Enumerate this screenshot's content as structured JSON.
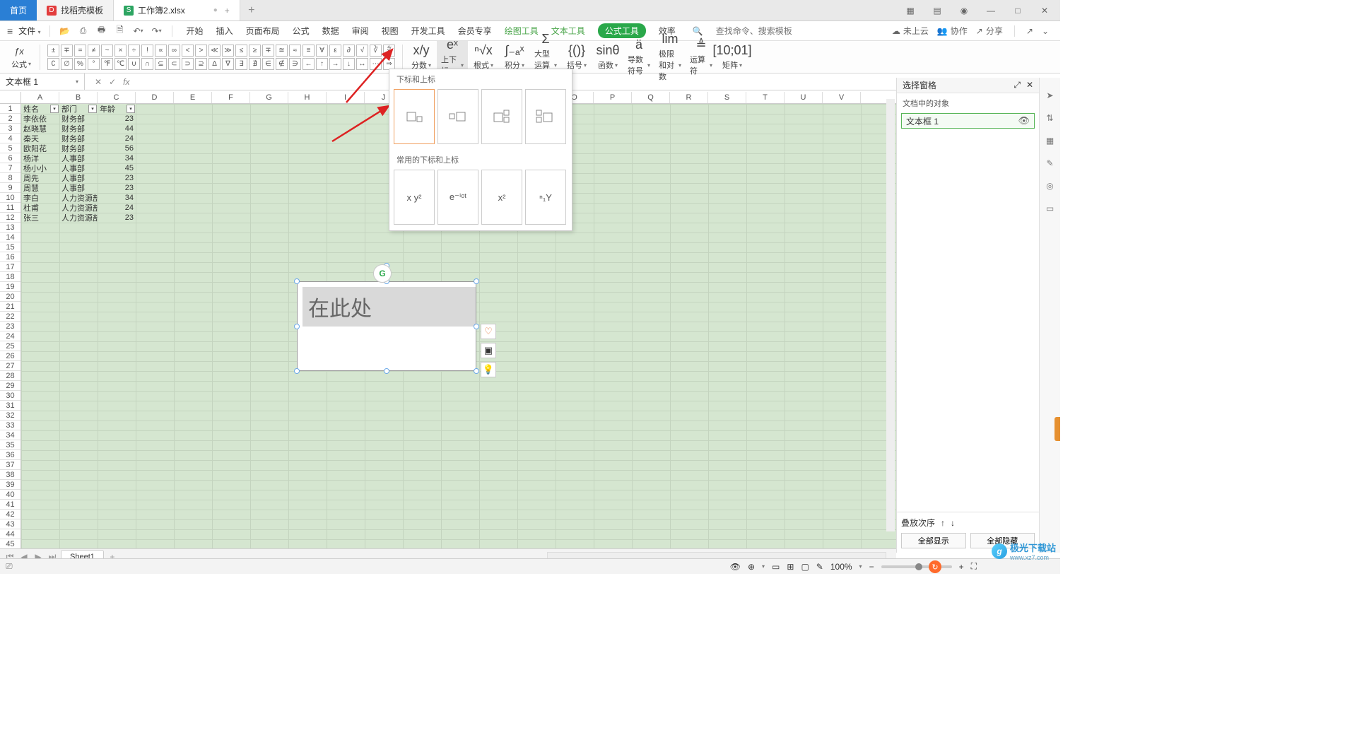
{
  "tabs": {
    "home": "首页",
    "template": "找稻壳模板",
    "doc": "工作簿2.xlsx",
    "dot": "●",
    "plus": "+"
  },
  "window_icons": {
    "grid": "▦",
    "apps": "▤",
    "user": "◉",
    "min": "—",
    "max": "□",
    "close": "✕"
  },
  "menu": {
    "file": "文件",
    "quick": {
      "open": "📂",
      "save": "⎙",
      "print": "🖶",
      "preview": "🗎",
      "undo": "↶",
      "redo": "↷"
    },
    "items": [
      "开始",
      "插入",
      "页面布局",
      "公式",
      "数据",
      "审阅",
      "视图",
      "开发工具",
      "会员专享"
    ],
    "draw": "绘图工具",
    "text": "文本工具",
    "formula": "公式工具",
    "effect": "效率",
    "search_placeholder": "查找命令、搜索模板",
    "cloud": "未上云",
    "collab": "协作",
    "share": "分享"
  },
  "ribbon": {
    "row1": [
      "±",
      "∓",
      "=",
      "≠",
      "~",
      "×",
      "÷",
      "!",
      "∝",
      "∞",
      "<",
      ">",
      "≪",
      "≫",
      "≤",
      "≥",
      "∓",
      "≅",
      "≈",
      "≡",
      "∀",
      "ε",
      "∂",
      "√",
      "∛",
      "∜"
    ],
    "row2": [
      "∁",
      "∅",
      "%",
      "°",
      "℉",
      "℃",
      "∪",
      "∩",
      "⊆",
      "⊂",
      "⊃",
      "⊇",
      "∆",
      "∇",
      "∃",
      "∄",
      "∈",
      "∉",
      "∋",
      "←",
      "↑",
      "→",
      "↓",
      "↔",
      "⋯",
      "⇒"
    ],
    "fx": "公式",
    "groups": [
      {
        "icon": "x/y",
        "label": "分数",
        "arrow": true
      },
      {
        "icon": "eˣ",
        "label": "上下标",
        "arrow": true,
        "active": true
      },
      {
        "icon": "ⁿ√x",
        "label": "根式",
        "arrow": true
      },
      {
        "icon": "∫₋ₐˣ",
        "label": "积分",
        "arrow": true
      },
      {
        "icon": "Σ",
        "label": "大型运算符",
        "arrow": true
      },
      {
        "icon": "{()} ",
        "label": "括号",
        "arrow": true
      },
      {
        "icon": "sinθ",
        "label": "函数",
        "arrow": true
      },
      {
        "icon": "ä",
        "label": "导数符号",
        "arrow": true
      },
      {
        "icon": "lim",
        "label": "极限和对数",
        "arrow": true
      },
      {
        "icon": "≜",
        "label": "运算符",
        "arrow": true
      },
      {
        "icon": "[10;01]",
        "label": "矩阵",
        "arrow": true
      }
    ]
  },
  "namebox": "文本框 1",
  "dropdown": {
    "title1": "下标和上标",
    "row1": [
      "□▫",
      "▫□",
      "□▫▫",
      "▫□▫"
    ],
    "title2": "常用的下标和上标",
    "row2": [
      "x y²",
      "e⁻ⁱᵒᵗ",
      "x²",
      "ⁿ₁Y"
    ]
  },
  "columns": [
    "A",
    "B",
    "C",
    "D",
    "E",
    "F",
    "G",
    "H",
    "I",
    "J",
    "K",
    "L",
    "M",
    "N",
    "O",
    "P",
    "Q",
    "R",
    "S",
    "T",
    "U",
    "V"
  ],
  "rows": 45,
  "table": {
    "headers": [
      "姓名",
      "部门",
      "年龄"
    ],
    "rows": [
      [
        "李依依",
        "财务部",
        "23"
      ],
      [
        "赵晓慧",
        "财务部",
        "44"
      ],
      [
        "秦天",
        "财务部",
        "24"
      ],
      [
        "欧阳花",
        "财务部",
        "56"
      ],
      [
        "杨洋",
        "人事部",
        "34"
      ],
      [
        "杨小小",
        "人事部",
        "45"
      ],
      [
        "周先",
        "人事部",
        "23"
      ],
      [
        "周慧",
        "人事部",
        "23"
      ],
      [
        "李白",
        "人力资源部",
        "34"
      ],
      [
        "杜甫",
        "人力资源部",
        "24"
      ],
      [
        "张三",
        "人力资源部",
        "23"
      ]
    ]
  },
  "textbox": {
    "text": "在此处"
  },
  "side_icons": [
    "♡",
    "▣",
    "💡"
  ],
  "selection_pane": {
    "title": "选择窗格",
    "subtitle": "文档中的对象",
    "item": "文本框 1",
    "stack": "叠放次序",
    "show_all": "全部显示",
    "hide_all": "全部隐藏"
  },
  "right_strip": [
    "➤",
    "⇅",
    "▦",
    "✎",
    "◎",
    "▭"
  ],
  "sheet_tabs": {
    "sheet": "Sheet1"
  },
  "status": {
    "zoom": "100%",
    "icons": [
      "👁",
      "⊕",
      "▭",
      "⊞",
      "▢",
      "✎"
    ]
  },
  "watermark": {
    "name": "极光下载站",
    "url": "www.xz7.com"
  }
}
